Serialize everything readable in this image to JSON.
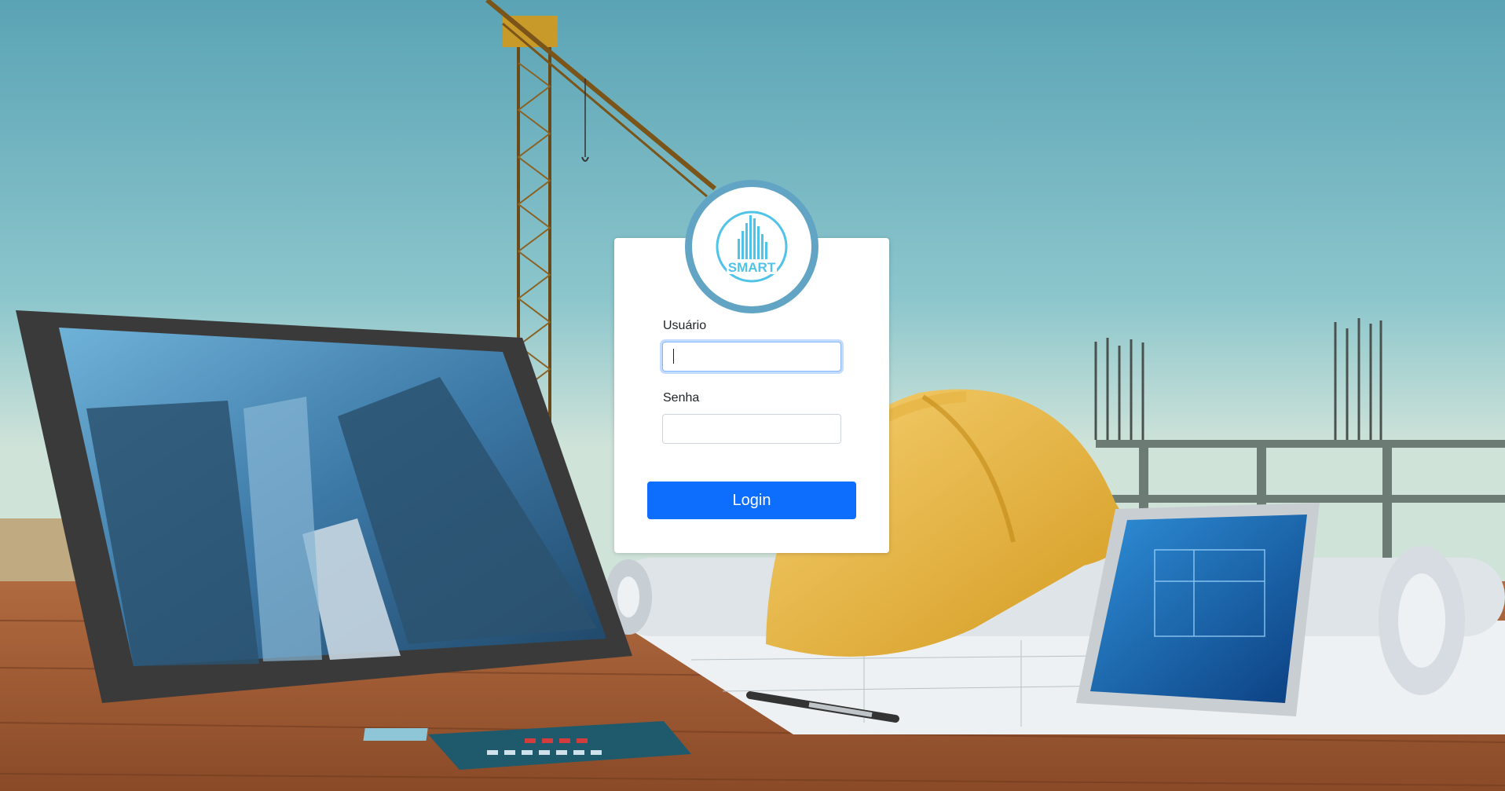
{
  "background": {
    "description_icons": [
      "crane",
      "tablet-skyscrapers",
      "hard-hat",
      "blueprints",
      "phone-blueprint",
      "calculator",
      "pen",
      "wooden-desk"
    ]
  },
  "logo": {
    "text": "SMART",
    "color": "#4fc3e8",
    "ring_color": "#62a4c4"
  },
  "form": {
    "username_label": "Usuário",
    "username_value": "",
    "password_label": "Senha",
    "password_value": "",
    "login_label": "Login"
  },
  "colors": {
    "primary": "#0d6efd",
    "card": "#ffffff"
  }
}
